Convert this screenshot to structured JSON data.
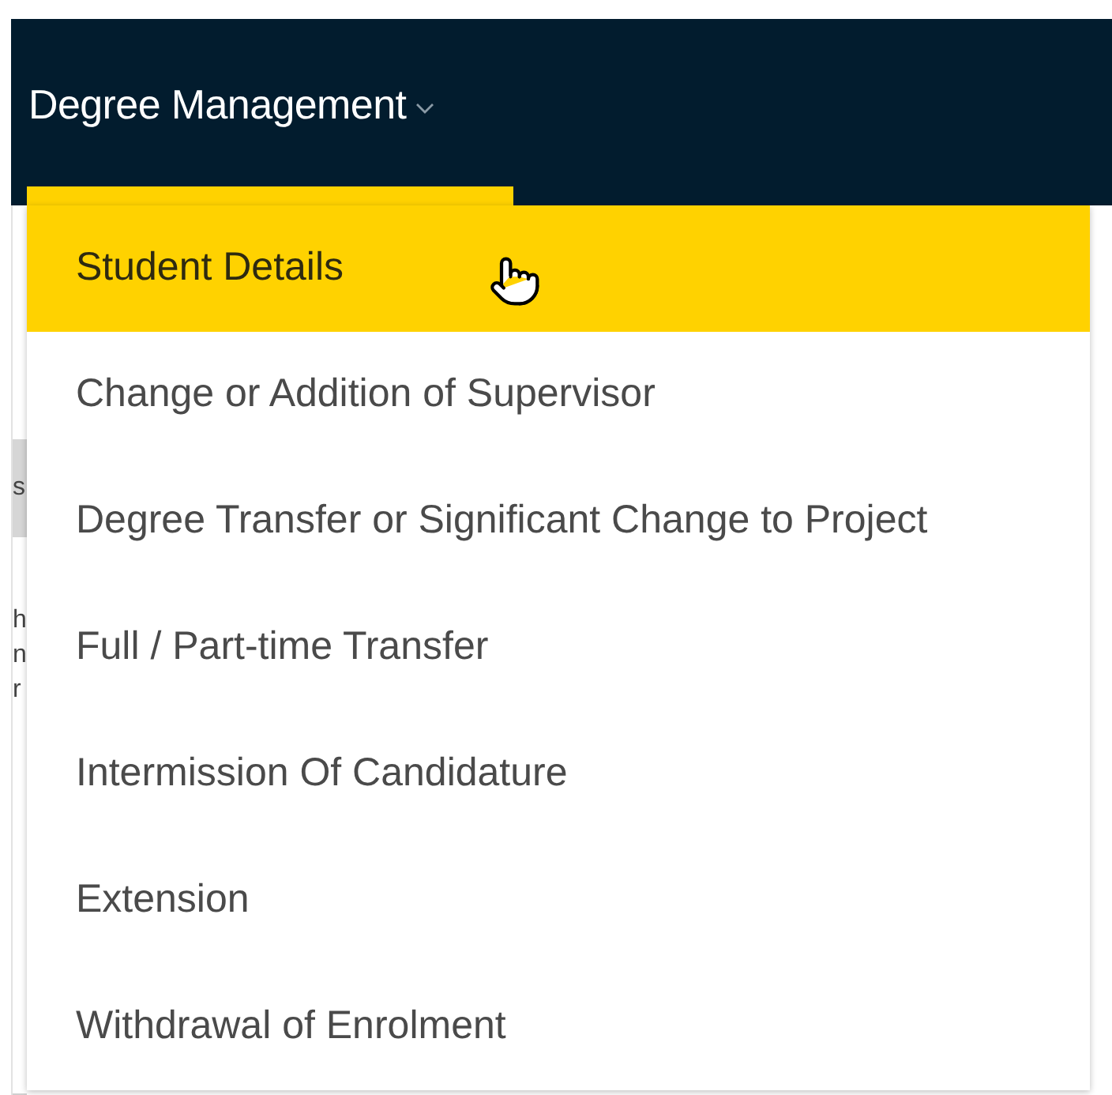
{
  "navbar": {
    "menu_label": "Degree Management",
    "expanded": true
  },
  "background": {
    "tab_label": "s",
    "lines": [
      "h",
      "n",
      "r"
    ]
  },
  "dropdown": {
    "items": [
      {
        "label": "Student Details",
        "selected": true
      },
      {
        "label": "Change or Addition of Supervisor",
        "selected": false
      },
      {
        "label": "Degree Transfer or Significant Change to Project",
        "selected": false
      },
      {
        "label": "Full / Part-time Transfer",
        "selected": false
      },
      {
        "label": "Intermission Of Candidature",
        "selected": false
      },
      {
        "label": "Extension",
        "selected": false
      },
      {
        "label": "Withdrawal of Enrolment",
        "selected": false
      }
    ]
  }
}
